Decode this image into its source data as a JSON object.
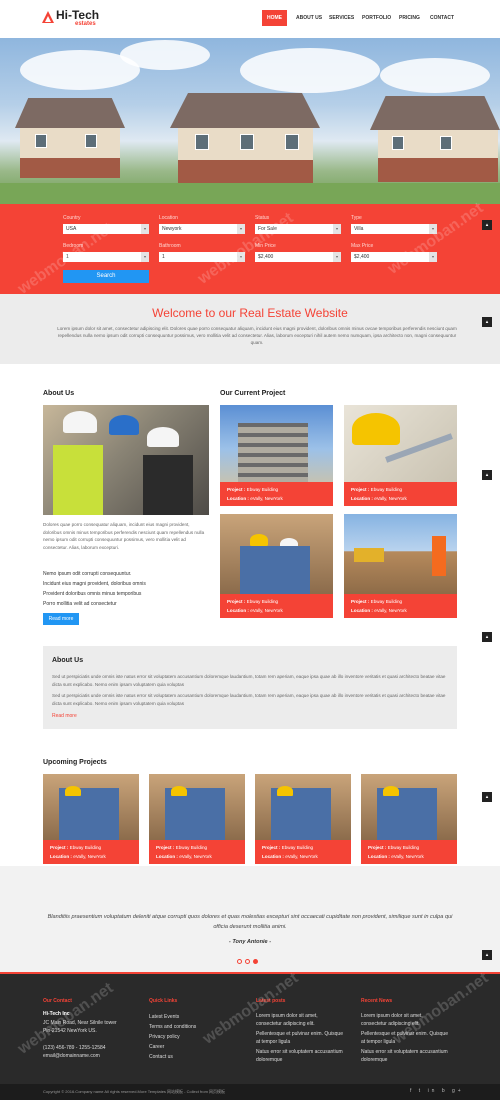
{
  "brand": {
    "name": "Hi-Tech",
    "sub": "estates"
  },
  "nav": [
    "HOME",
    "ABOUT US",
    "SERVICES",
    "PORTFOLIO",
    "PRICING",
    "CONTACT"
  ],
  "search": {
    "country_label": "Country",
    "country": "USA",
    "location_label": "Location",
    "location": "Newyork",
    "status_label": "Status",
    "status": "For Sale",
    "type_label": "Type",
    "type": "Villa",
    "bedroom_label": "Bedroom",
    "bedroom": "1",
    "bathroom_label": "Bathroom",
    "bathroom": "1",
    "minprice_label": "Min Price",
    "minprice": "$2,400",
    "maxprice_label": "Max Price",
    "maxprice": "$2,400",
    "button": "Search"
  },
  "welcome": {
    "title": "Welcome to our Real Estate Website",
    "text": "Lorem ipsum dolor sit amet, consectetur adipiscing elit. Dolores quae porro consequatur aliquam, incidunt eius magni provident, doloribus omnis minus ovcae temporibus perferendis nesciunt quam repellendus nulla nemo ipsum odit corrupti consequuntur possimus, vero mollitia velit ad consectetur. Alias, laborum excepturi nihil autem nemo numquam, ipsa architecto non, magni consequuntur quam."
  },
  "about": {
    "heading": "About Us",
    "text": "Dolores quae porro consequatur aliquam, incidunt eius magni provident, doloribus omnis minus temporibus perferendis nesciunt quam repellendus nulla nemo ipsum odit corrupti consequuntur possimus, vero mollitia velit ad consectetur. Alias, laborum excepturi.",
    "bullets": [
      "Nemo ipsum odit corrupti consequuntur.",
      "Incidunt eius magni provident, doloribus omnis",
      "Provident doloribus omnis minus temporibus",
      "Porro mollitia velit ad consectetur"
    ],
    "readmore": "Read more"
  },
  "current": {
    "heading": "Our Current Project",
    "cards": [
      {
        "project_label": "Project :",
        "project": "Ebway Building",
        "location_label": "Location :",
        "location": "eVally, NewYork"
      },
      {
        "project_label": "Project :",
        "project": "Ebway Building",
        "location_label": "Location :",
        "location": "eVally, NewYork"
      },
      {
        "project_label": "Project :",
        "project": "Ebway Building",
        "location_label": "Location :",
        "location": "eVally, NewYork"
      },
      {
        "project_label": "Project :",
        "project": "Ebway Building",
        "location_label": "Location :",
        "location": "eVally, NewYork"
      }
    ]
  },
  "aboutbox": {
    "heading": "About Us",
    "p1": "Sed ut perspiciatis unde omnis iste natus error sit voluptatem accusantium doloremque laudantium, totam rem aperiam, eaque ipsa quae ab illo inventore veritatis et quasi architecto beatae vitae dicta sunt explicabo. Nemo enim ipsam voluptatem quia voluptas",
    "p2": "Sed ut perspiciatis unde omnis iste natus error sit voluptatem accusantium doloremque laudantium, totam rem aperiam, eaque ipsa quae ab illo inventore veritatis et quasi architecto beatae vitae dicta sunt explicabo. Nemo enim ipsam voluptatem quia voluptas",
    "readmore": "Read more"
  },
  "upcoming": {
    "heading": "Upcoming Projects",
    "cards": [
      {
        "project_label": "Project :",
        "project": "Ebway Building",
        "location_label": "Location :",
        "location": "eVally, NewYork"
      },
      {
        "project_label": "Project :",
        "project": "Ebway Building",
        "location_label": "Location :",
        "location": "eVally, NewYork"
      },
      {
        "project_label": "Project :",
        "project": "Ebway Building",
        "location_label": "Location :",
        "location": "eVally, NewYork"
      },
      {
        "project_label": "Project :",
        "project": "Ebway Building",
        "location_label": "Location :",
        "location": "eVally, NewYork"
      }
    ]
  },
  "testimonial": {
    "quote": "Blanditiis praesentium voluptatum deleniti atque corrupti quos dolores et quas molestias excepturi sint occaecati cupiditate non provident, similique sunt in culpa qui officia deserunt mollitia animi.",
    "author": "- Tony Antonie -"
  },
  "footer": {
    "contact_h": "Our Contact",
    "company": "Hi-Tech Inc",
    "addr1": "JC Main Road, Near Silnile tower",
    "addr2": "Pin-21542 NewYork US.",
    "phone": "(123) 456-789 - 1255-12584",
    "email": "email@domainname.com",
    "links_h": "Quick Links",
    "links": [
      "Latest Events",
      "Terms and conditions",
      "Privacy policy",
      "Career",
      "Contact us"
    ],
    "posts_h": "Latest posts",
    "posts": [
      "Lorem ipsum dolor sit amet,",
      "consectetur adipiscing elit.",
      "Pellentesque et pulvinar enim. Quisque",
      "at tempor ligula",
      "Natus error sit voluptatem accusantium",
      "doloremque"
    ],
    "news_h": "Recent News",
    "news": [
      "Lorem ipsum dolor sit amet,",
      "consectetur adipiscing elit.",
      "Pellentesque et pulvinar enim. Quisque",
      "at tempor ligula",
      "Natus error sit voluptatem accusantium",
      "doloremque"
    ],
    "copyright": "Copyright © 2016.Company name All rights reserved.More Templates 网站模板 - Collect from 网页模板",
    "social": [
      "f",
      "t",
      "in",
      "b",
      "g+"
    ]
  },
  "watermark": "webmoban.net"
}
